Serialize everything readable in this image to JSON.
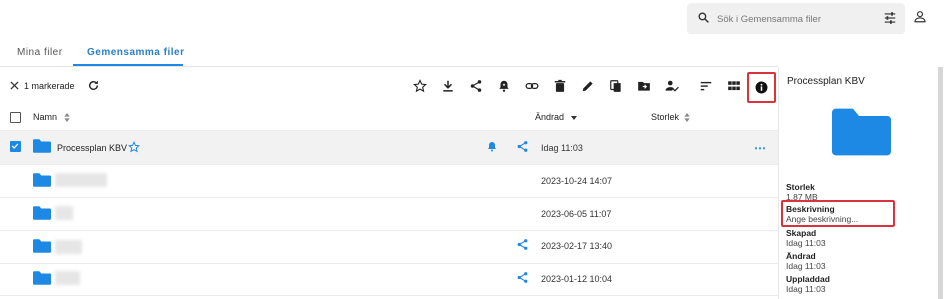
{
  "search": {
    "placeholder": "Sök i Gemensamma filer"
  },
  "tabs": [
    {
      "label": "Mina filer"
    },
    {
      "label": "Gemensamma filer"
    }
  ],
  "toolbar": {
    "selection_label": "1 markerade"
  },
  "table": {
    "headers": {
      "name": "Namn",
      "modified": "Ändrad",
      "size": "Storlek"
    },
    "rows": [
      {
        "name": "Processplan KBV",
        "modified": "Idag 11:03",
        "selected": true
      },
      {
        "name": "",
        "modified": "2023-10-24 14:07"
      },
      {
        "name": "",
        "modified": "2023-06-05 11:07"
      },
      {
        "name": "",
        "modified": "2023-02-17 13:40"
      },
      {
        "name": "",
        "modified": "2023-01-12 10:04"
      }
    ]
  },
  "panel": {
    "title": "Processplan KBV",
    "size_label": "Storlek",
    "size_value": "1.87 MB",
    "description_label": "Beskrivning",
    "description_value": "Ange beskrivning...",
    "created_label": "Skapad",
    "created_value": "Idag 11:03",
    "modified_label": "Ändrad",
    "modified_value": "Idag 11:03",
    "uploaded_label": "Uppladdad",
    "uploaded_value": "Idag 11:03"
  },
  "colors": {
    "accent": "#1e88e5",
    "folder": "#1e88e5",
    "highlight": "#d9343e"
  }
}
